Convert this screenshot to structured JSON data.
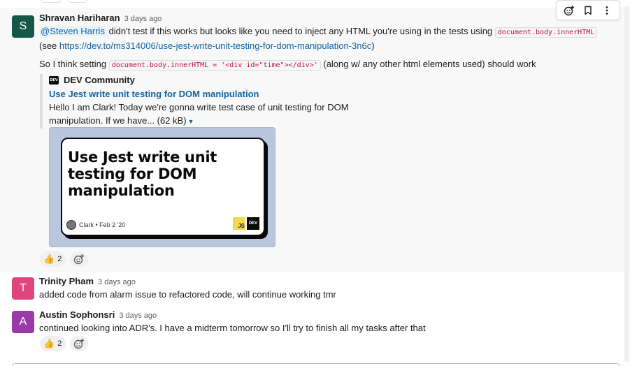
{
  "messages": [
    {
      "sender": "Shravan Hariharan",
      "avatar_letter": "S",
      "avatar_color": "#16574a",
      "time": "3 days ago",
      "line1": {
        "mention": "@Steven Harris",
        "text_a": " didn't test if this works but looks like you need to inject any HTML you're using in the tests using ",
        "code": "document.body.innerHTML"
      },
      "line2": {
        "prefix": "(see ",
        "link": "https://dev.to/ms314006/use-jest-write-unit-testing-for-dom-manipulation-3n6c",
        "suffix": ")"
      },
      "line3": {
        "prefix": "So I think setting ",
        "code": "document.body.innerHTML = '<div id=\"time\"></div>'",
        "suffix": " (along w/ any other html elements used) should work"
      },
      "attachment": {
        "source": "DEV Community",
        "source_badge": "DEV",
        "title": "Use Jest write unit testing for DOM manipulation",
        "description": "Hello I am Clark! Today we're gonna write test case of unit testing for DOM manipulation. If we have... (62 kB)",
        "preview_title": "Use Jest write unit testing for DOM manipulation",
        "preview_author": "Clark • Feb 2 '20",
        "preview_js": "JS",
        "preview_dev": "DEV"
      },
      "reactions": [
        {
          "emoji": "👍",
          "count": "2"
        }
      ]
    },
    {
      "sender": "Trinity Pham",
      "avatar_letter": "T",
      "avatar_color": "#e0457b",
      "time": "3 days ago",
      "text": "added code from alarm issue to refactored code, will continue working tmr"
    },
    {
      "sender": "Austin Sophonsri",
      "avatar_letter": "A",
      "avatar_color": "#9b3aa8",
      "time": "3 days ago",
      "text": "continued looking into ADR's. I have a midterm tomorrow so I'll try to finish all my tasks after that",
      "reactions": [
        {
          "emoji": "👍",
          "count": "2"
        }
      ]
    }
  ],
  "toolbar": {
    "icons": [
      "add-reaction-icon",
      "bookmark-icon",
      "more-actions-icon"
    ]
  }
}
